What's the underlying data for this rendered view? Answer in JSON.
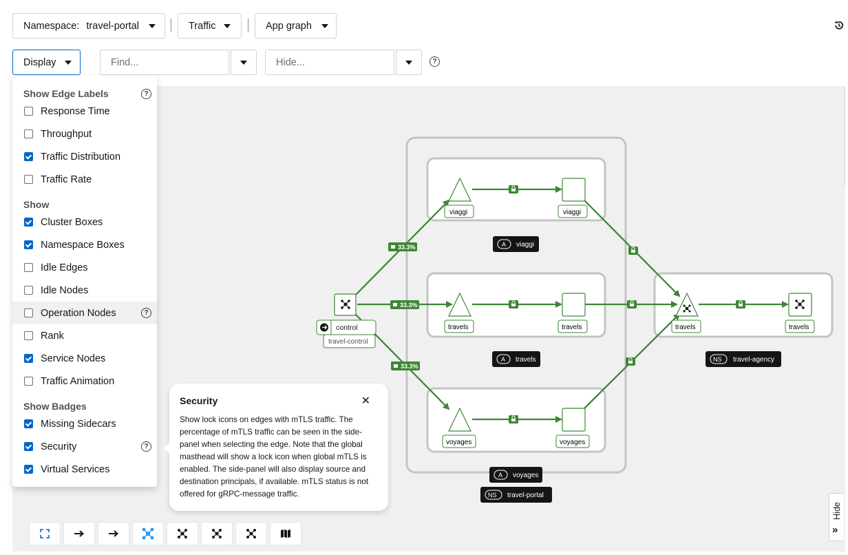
{
  "toolbar": {
    "namespace_label": "Namespace:",
    "namespace_value": "travel-portal",
    "traffic": "Traffic",
    "graph_type": "App graph",
    "display": "Display",
    "find_placeholder": "Find...",
    "hide_placeholder": "Hide..."
  },
  "display_menu": {
    "edge_labels_heading": "Show Edge Labels",
    "edge_labels": [
      {
        "label": "Response Time",
        "checked": false
      },
      {
        "label": "Throughput",
        "checked": false
      },
      {
        "label": "Traffic Distribution",
        "checked": true
      },
      {
        "label": "Traffic Rate",
        "checked": false
      }
    ],
    "show_heading": "Show",
    "show": [
      {
        "label": "Cluster Boxes",
        "checked": true
      },
      {
        "label": "Namespace Boxes",
        "checked": true
      },
      {
        "label": "Idle Edges",
        "checked": false
      },
      {
        "label": "Idle Nodes",
        "checked": false
      },
      {
        "label": "Operation Nodes",
        "checked": false
      },
      {
        "label": "Rank",
        "checked": false
      },
      {
        "label": "Service Nodes",
        "checked": true
      },
      {
        "label": "Traffic Animation",
        "checked": false
      }
    ],
    "badges_heading": "Show Badges",
    "badges": [
      {
        "label": "Missing Sidecars",
        "checked": true
      },
      {
        "label": "Security",
        "checked": true
      },
      {
        "label": "Virtual Services",
        "checked": true
      }
    ]
  },
  "tooltip": {
    "title": "Security",
    "body": "Show lock icons on edges with mTLS traffic. The percentage of mTLS traffic can be seen in the side-panel when selecting the edge. Note that the global masthead will show a lock icon when global mTLS is enabled. The side-panel will also display source and destination principals, if available. mTLS status is not offered for gRPC-message traffic."
  },
  "graph": {
    "edge_pct": "33.3%",
    "nodes": {
      "control": "control",
      "travel_control": "travel-control",
      "viaggi": "viaggi",
      "travels": "travels",
      "voyages": "voyages"
    },
    "boxes": {
      "app_badge": "A",
      "ns_badge": "NS",
      "app_viaggi": "viaggi",
      "app_travels": "travels",
      "app_voyages": "voyages",
      "ns_portal": "travel-portal",
      "ns_agency": "travel-agency"
    }
  },
  "hide_tab": "Hide",
  "colors": {
    "accent": "#0066cc",
    "edge": "#3e8635",
    "box_border": "#c0c0c0",
    "label_bg": "#151515"
  }
}
